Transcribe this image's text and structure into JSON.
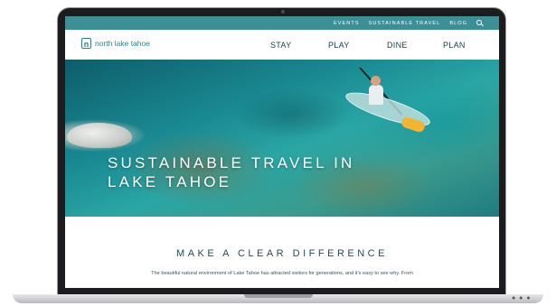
{
  "utility_nav": {
    "links": [
      "EVENTS",
      "SUSTAINABLE TRAVEL",
      "BLOG"
    ],
    "search_icon": "search-icon"
  },
  "header": {
    "logo_mark": "n",
    "logo_text": "north lake tahoe",
    "nav": [
      "STAY",
      "PLAY",
      "DINE",
      "PLAN"
    ]
  },
  "hero": {
    "title_line1": "SUSTAINABLE TRAVEL IN",
    "title_line2": "LAKE TAHOE"
  },
  "intro": {
    "heading": "MAKE A CLEAR DIFFERENCE",
    "body": "The beautiful natural environment of Lake Tahoe has attracted visitors for generations, and it's easy to see why. From"
  },
  "colors": {
    "utility_bar": "#3d8f96",
    "brand": "#2f7f88",
    "heading": "#274a5a"
  }
}
